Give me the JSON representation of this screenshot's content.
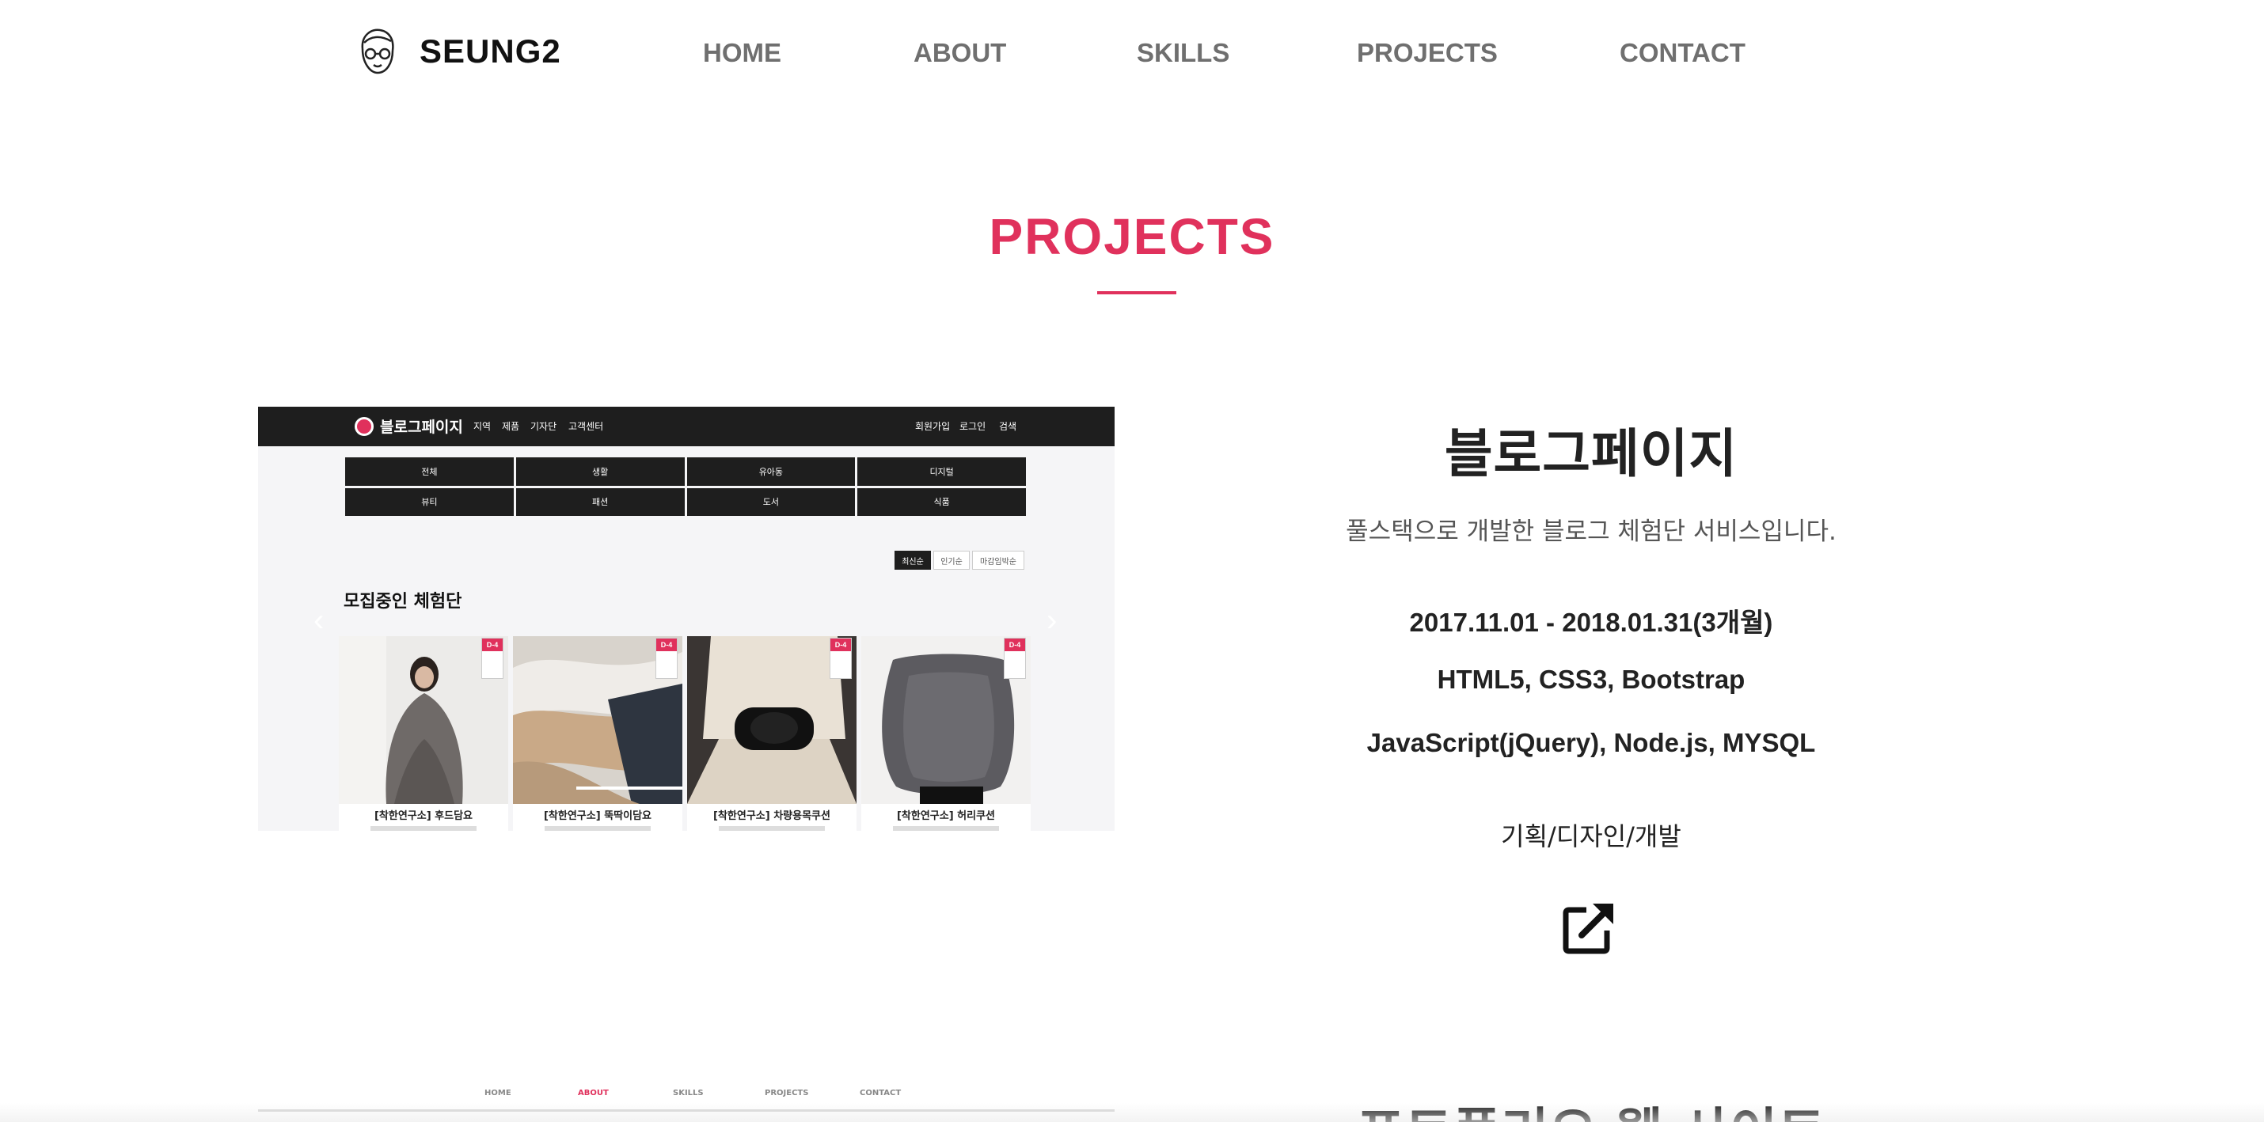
{
  "header": {
    "logo_text": "SEUNG2",
    "nav": [
      {
        "label": "HOME"
      },
      {
        "label": "ABOUT"
      },
      {
        "label": "SKILLS"
      },
      {
        "label": "PROJECTS"
      },
      {
        "label": "CONTACT"
      }
    ]
  },
  "section": {
    "title": "PROJECTS",
    "accent_color": "#e0315c"
  },
  "projects": [
    {
      "title": "블로그페이지",
      "description": "풀스택으로 개발한 블로그 체험단 서비스입니다.",
      "period": "2017.11.01 - 2018.01.31(3개월)",
      "stack_1": "HTML5, CSS3, Bootstrap",
      "stack_2": "JavaScript(jQuery), Node.js, MYSQL",
      "role": "기획/디자인/개발",
      "link_icon": "external-link-icon",
      "screenshot": {
        "logo_text": "블로그페이지",
        "menu_left": [
          "지역",
          "제품",
          "기자단",
          "고객센터"
        ],
        "menu_right": [
          "회원가입",
          "로그인",
          "검색"
        ],
        "categories": [
          "전체",
          "생활",
          "유아동",
          "디지털",
          "뷰티",
          "패션",
          "도서",
          "식품"
        ],
        "sort": [
          "최신순",
          "인기순",
          "마감임박순"
        ],
        "heading": "모집중인 체험단",
        "cards": [
          {
            "title": "[착한연구소] 후드담요",
            "badge": "D-4"
          },
          {
            "title": "[착한연구소] 뚝딱이담요",
            "badge": "D-4"
          },
          {
            "title": "[착한연구소] 차량용목쿠션",
            "badge": "D-4"
          },
          {
            "title": "[착한연구소] 허리쿠션",
            "badge": "D-4"
          }
        ]
      }
    },
    {
      "title": "포트폴리오 웹 사이트",
      "screenshot": {
        "nav": [
          "HOME",
          "ABOUT",
          "SKILLS",
          "PROJECTS",
          "CONTACT"
        ]
      }
    }
  ]
}
